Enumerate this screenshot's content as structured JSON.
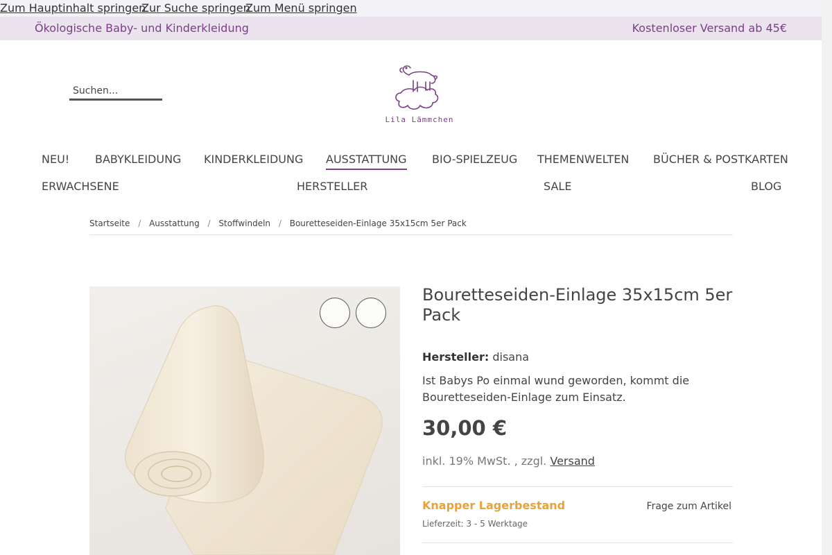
{
  "skip_links": [
    "Zum Hauptinhalt springen",
    "Zur Suche springen",
    "Zum Menü springen"
  ],
  "topbar": {
    "left_text": "Ökologische Baby- und Kinderkleidung",
    "right_text": "Kostenloser Versand ab 45€"
  },
  "search": {
    "placeholder": "Suchen..."
  },
  "logo": {
    "text": "Lila Lämmchen"
  },
  "nav": {
    "row1": [
      "NEU!",
      "BABYKLEIDUNG",
      "KINDERKLEIDUNG",
      "AUSSTATTUNG",
      "BIO-SPIELZEUG",
      "THEMENWELTEN",
      "BÜCHER & POSTKARTEN"
    ],
    "row2": [
      "ERWACHSENE",
      "HERSTELLER",
      "SALE",
      "BLOG"
    ],
    "active": "AUSSTATTUNG"
  },
  "breadcrumb": [
    "Startseite",
    "Ausstattung",
    "Stoffwindeln",
    "Bouretteseiden-Einlage 35x15cm 5er Pack"
  ],
  "product": {
    "title": "Bouretteseiden-Einlage 35x15cm 5er Pack",
    "manufacturer_label": "Hersteller:",
    "manufacturer": "disana",
    "description": "Ist Babys Po einmal wund geworden, kommt die Bouretteseiden-Einlage zum Einsatz.",
    "price": "30,00 €",
    "tax_text": "inkl. 19% MwSt. , zzgl.",
    "shipping_link": "Versand",
    "stock_status": "Knapper Lagerbestand",
    "delivery_time": "Lieferzeit: 3 - 5 Werktage",
    "question_link": "Frage zum Artikel"
  },
  "colors": {
    "brand": "#7a3f86",
    "topbar_bg": "#ebe4ee",
    "stock": "#e8a23a"
  }
}
